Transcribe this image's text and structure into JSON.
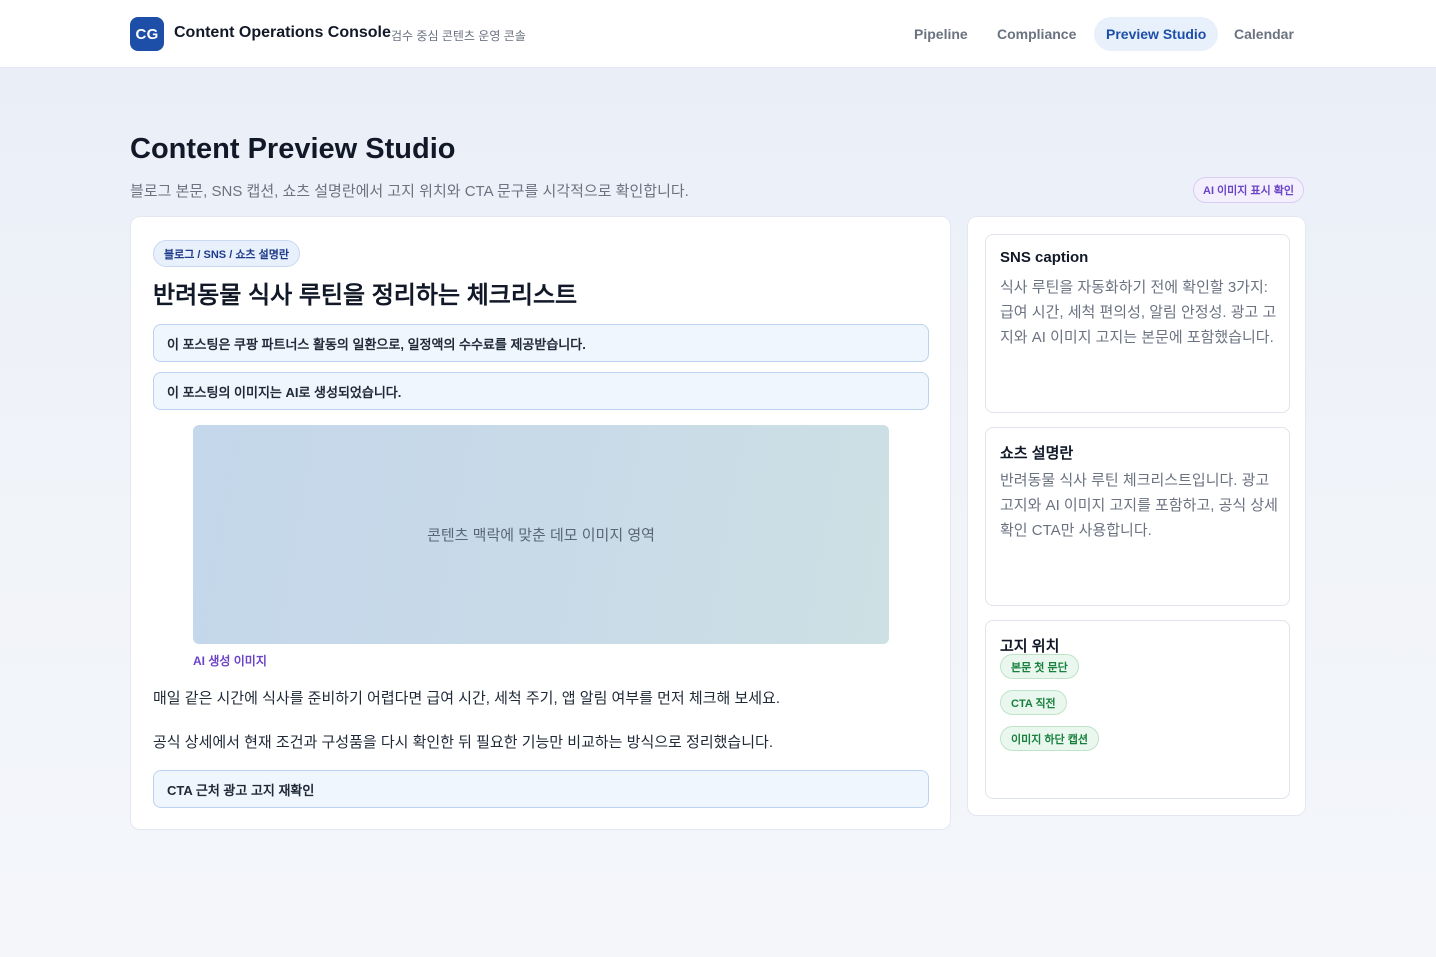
{
  "app": {
    "logo_text": "CG",
    "title": "Content Operations Console",
    "subtitle": "검수 중심 콘텐츠 운영 콘솔"
  },
  "nav": {
    "items": [
      {
        "label": "Pipeline",
        "active": false
      },
      {
        "label": "Compliance",
        "active": false
      },
      {
        "label": "Preview Studio",
        "active": true
      },
      {
        "label": "Calendar",
        "active": false
      }
    ]
  },
  "header": {
    "title": "Content Preview Studio",
    "description": "블로그 본문, SNS 캡션, 쇼츠 설명란에서 고지 위치와 CTA 문구를 시각적으로 확인합니다.",
    "badge": "AI 이미지 표시 확인"
  },
  "preview": {
    "channel_pill": "블로그 / SNS / 쇼츠 설명란",
    "post_title": "반려동물 식사 루틴을 정리하는 체크리스트",
    "notices": [
      "이 포스팅은 쿠팡 파트너스 활동의 일환으로, 일정액의 수수료를 제공받습니다.",
      "이 포스팅의 이미지는 AI로 생성되었습니다."
    ],
    "image_placeholder": "콘텐츠 맥락에 맞춘 데모 이미지 영역",
    "image_caption": "AI 생성 이미지",
    "paragraphs": [
      "매일 같은 시간에 식사를 준비하기 어렵다면 급여 시간, 세척 주기, 앱 알림 여부를 먼저 체크해 보세요.",
      "공식 상세에서 현재 조건과 구성품을 다시 확인한 뒤 필요한 기능만 비교하는 방식으로 정리했습니다."
    ],
    "cta_notice": "CTA 근처 광고 고지 재확인"
  },
  "side": {
    "sns": {
      "title": "SNS caption",
      "text": "식사 루틴을 자동화하기 전에 확인할 3가지: 급여 시간, 세척 편의성, 알림 안정성. 광고 고지와 AI 이미지 고지는 본문에 포함했습니다."
    },
    "shorts": {
      "title": "쇼츠 설명란",
      "text": "반려동물 식사 루틴 체크리스트입니다. 광고 고지와 AI 이미지 고지를 포함하고, 공식 상세 확인 CTA만 사용합니다."
    },
    "positions": {
      "title": "고지 위치",
      "chips": [
        "본문 첫 문단",
        "CTA 직전",
        "이미지 하단 캡션"
      ]
    }
  },
  "colors": {
    "accent": "#1e4fa8",
    "ai_purple": "#6b44c7",
    "success_green": "#17803d"
  }
}
